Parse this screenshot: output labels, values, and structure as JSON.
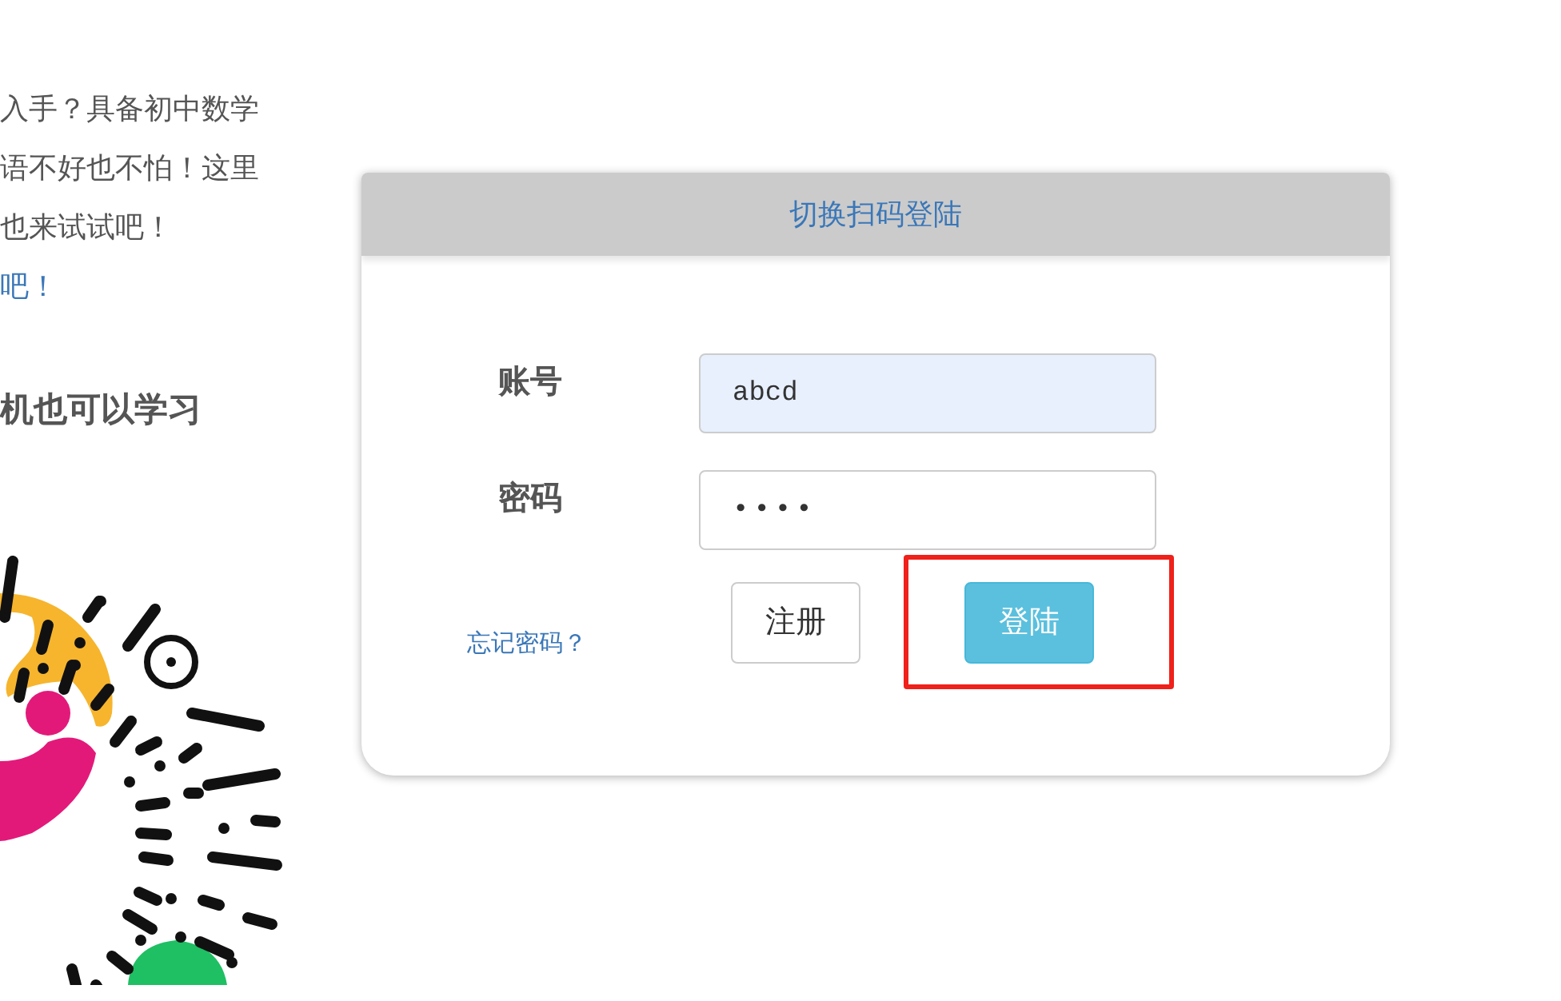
{
  "intro": {
    "lines": [
      {
        "text": "入手？具备初中数学",
        "kind": "text"
      },
      {
        "text": "语不好也不怕！这里",
        "kind": "text"
      },
      {
        "text": "也来试试吧！",
        "kind": "text"
      },
      {
        "text": "吧！",
        "kind": "link"
      }
    ],
    "heading": "机也可以学习"
  },
  "login": {
    "header": "切换扫码登陆",
    "fields": [
      {
        "label": "账号",
        "value": "abcd",
        "kind": "text"
      },
      {
        "label": "密码",
        "value": "••••",
        "kind": "password"
      }
    ],
    "forgot_link": "忘记密码？",
    "buttons": [
      {
        "label": "注册",
        "kind": "secondary",
        "highlighted": false
      },
      {
        "label": "登陆",
        "kind": "primary",
        "highlighted": true
      }
    ]
  }
}
